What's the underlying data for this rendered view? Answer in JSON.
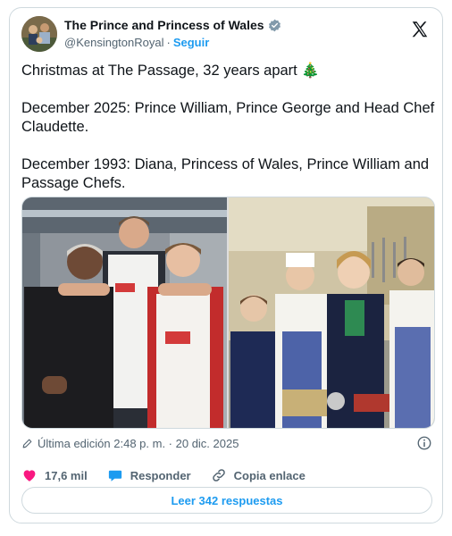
{
  "header": {
    "display_name": "The Prince and Princess of Wales",
    "handle": "@KensingtonRoyal",
    "separator": "·",
    "follow_label": "Seguir"
  },
  "tweet": {
    "line1": "Christmas at The Passage, 32 years apart 🎄",
    "line2": "December 2025: Prince William, Prince George and Head Chef Claudette.",
    "line3": "December 1993: Diana, Princess of Wales, Prince William and Passage Chefs."
  },
  "meta": {
    "edited_label": "Última edición 2:48 p. m. · 20 dic. 2025"
  },
  "actions": {
    "likes": "17,6 mil",
    "reply_label": "Responder",
    "copy_link_label": "Copia enlace"
  },
  "replies_button": "Leer 342 respuestas",
  "colors": {
    "accent": "#1d9bf0",
    "like": "#f91880",
    "muted": "#536471",
    "border": "#cfd9de"
  },
  "icons": [
    "x-logo-icon",
    "verified-badge-icon",
    "pencil-icon",
    "info-icon",
    "heart-icon",
    "reply-bubble-icon",
    "link-icon"
  ]
}
